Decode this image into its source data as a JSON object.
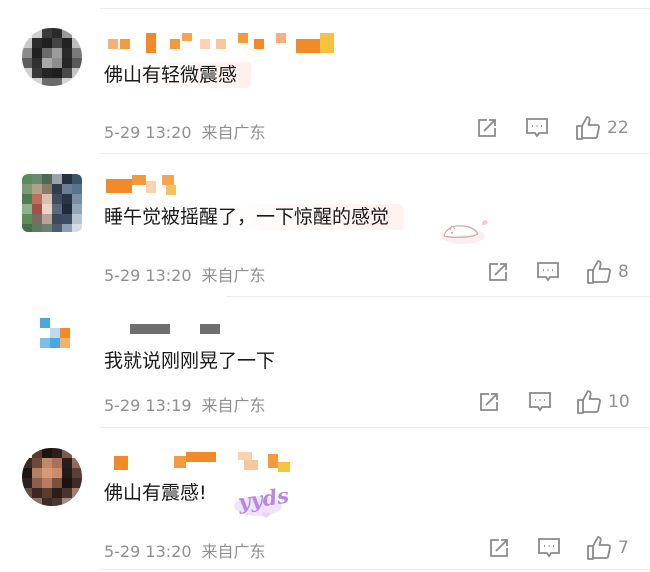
{
  "comments": [
    {
      "text": "佛山有轻微震感",
      "date": "5-29 13:20",
      "source": "来自广东",
      "likes": "22",
      "icons": [
        "repost-icon",
        "comment-icon",
        "like-icon"
      ]
    },
    {
      "text": "睡午觉被摇醒了，一下惊醒的感觉",
      "date": "5-29 13:20",
      "source": "来自广东",
      "likes": "8",
      "sticker_icon": "sleeping-cat-sticker-icon",
      "icons": [
        "repost-icon",
        "comment-icon",
        "like-icon"
      ]
    },
    {
      "text": "我就说刚刚晃了一下",
      "date": "5-29 13:19",
      "source": "来自广东",
      "likes": "10",
      "icons": [
        "repost-icon",
        "comment-icon",
        "like-icon"
      ]
    },
    {
      "text": "佛山有震感!",
      "date": "5-29 13:20",
      "source": "来自广东",
      "likes": "7",
      "sticker_text": "yyds",
      "sticker_color": "#b48be0",
      "icons": [
        "repost-icon",
        "comment-icon",
        "like-icon"
      ]
    }
  ],
  "colors": {
    "text": "#1a1a1a",
    "meta": "#8f8f8f",
    "icon": "#8a8a8a",
    "name_mosaic_orange": "#f39a3c",
    "divider": "#ededed"
  },
  "avatar_notes": "user avatars and nicknames are pixelated (mosaic) in the screenshot"
}
